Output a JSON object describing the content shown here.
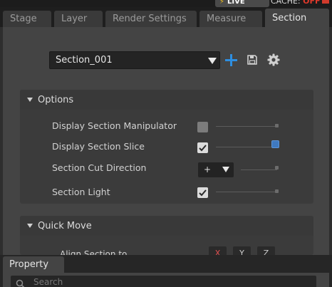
{
  "topbar": {
    "live_label": "LIVE",
    "cache_label": "CACHE: ",
    "cache_state": "OFF",
    "live_color": "#f3c21b",
    "cache_off_color": "#e0392b"
  },
  "tabs": [
    {
      "label": "Stage",
      "active": false
    },
    {
      "label": "Layer",
      "active": false
    },
    {
      "label": "Render Settings",
      "active": false
    },
    {
      "label": "Measure",
      "active": false
    },
    {
      "label": "Section",
      "active": true
    }
  ],
  "section_selector": {
    "value": "Section_001",
    "icons": [
      "plus-icon",
      "save-icon",
      "gear-icon"
    ],
    "accent_color": "#2d8ee0"
  },
  "options": {
    "title": "Options",
    "rows": [
      {
        "label": "Display Section Manipulator",
        "checked": false,
        "slider": 1.0
      },
      {
        "label": "Display Section Slice",
        "checked": true,
        "slider": 1.0
      },
      {
        "label": "Section Cut Direction",
        "value": "+",
        "slider": 1.0
      },
      {
        "label": "Section Light",
        "checked": true,
        "slider": 1.0
      }
    ]
  },
  "quick_move": {
    "title": "Quick Move",
    "row_label": "Align Section to",
    "axes": [
      "X",
      "Y",
      "Z"
    ]
  },
  "property": {
    "tab_label": "Property",
    "search_placeholder": "Search"
  }
}
